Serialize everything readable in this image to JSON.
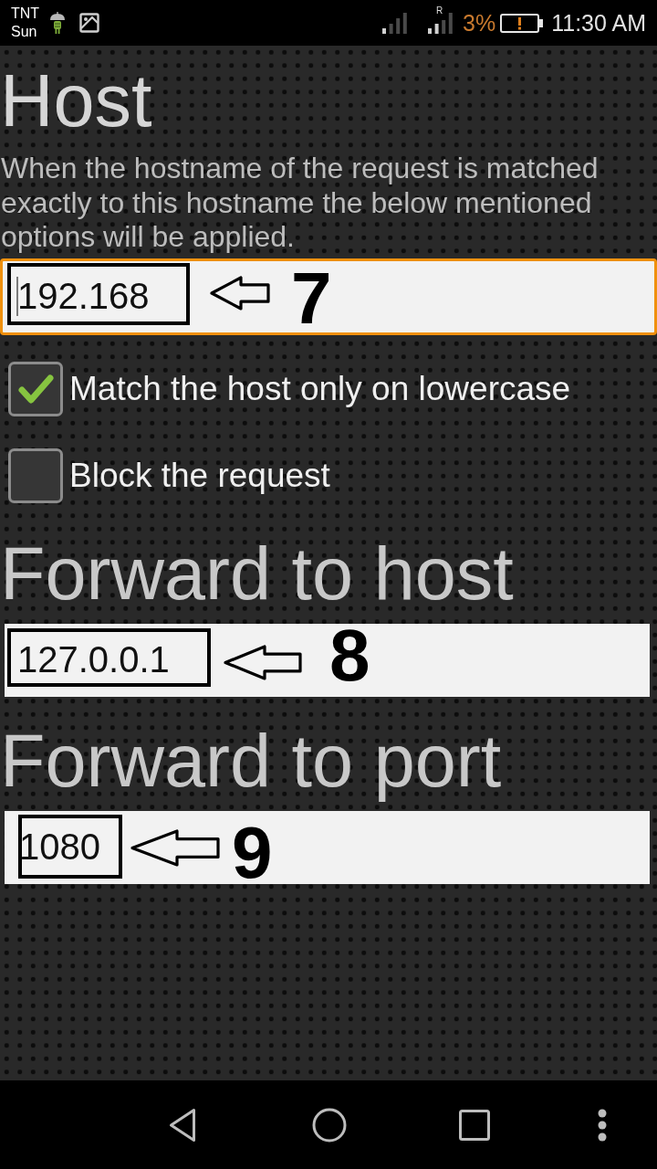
{
  "status_bar": {
    "carrier": [
      "TNT",
      "Sun"
    ],
    "roaming": "R",
    "battery": {
      "percent": "3%",
      "low": true
    },
    "time": "11:30 AM"
  },
  "host": {
    "title": "Host",
    "description": "When the hostname of the request is matched exactly to this hostname the below mentioned options will be applied.",
    "input": {
      "value": "192.168",
      "focused": true,
      "annotation": "7"
    }
  },
  "options": [
    {
      "label": "Match the host only on lowercase",
      "checked": true
    },
    {
      "label": "Block the request",
      "checked": false
    }
  ],
  "forward_host": {
    "title": "Forward to host",
    "input": {
      "value": "127.0.0.1",
      "focused": false,
      "annotation": "8"
    }
  },
  "forward_port": {
    "title": "Forward to port",
    "input": {
      "value": "1080",
      "focused": false,
      "annotation": "9"
    }
  }
}
